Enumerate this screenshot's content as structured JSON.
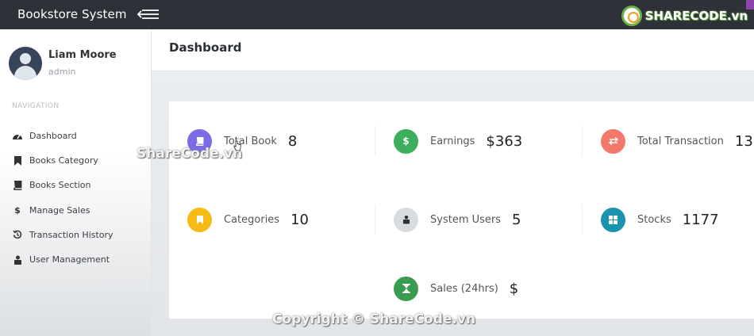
{
  "app": {
    "brand": "Bookstore System"
  },
  "watermark": {
    "logo_text": "SHARECODE.vn",
    "center_text": "ShareCode.vn",
    "footer_text": "Copyright © ShareCode.vn"
  },
  "user": {
    "name": "Liam Moore",
    "role": "admin"
  },
  "nav": {
    "header": "NAVIGATION",
    "items": [
      {
        "label": "Dashboard",
        "icon": "dashboard-icon"
      },
      {
        "label": "Books Category",
        "icon": "bookmark-icon"
      },
      {
        "label": "Books Section",
        "icon": "book-icon"
      },
      {
        "label": "Manage Sales",
        "icon": "dollar-icon"
      },
      {
        "label": "Transaction History",
        "icon": "history-icon"
      },
      {
        "label": "User Management",
        "icon": "user-lock-icon"
      }
    ]
  },
  "page": {
    "title": "Dashboard"
  },
  "stats": [
    {
      "label": "Total Book",
      "value": "8",
      "icon": "book-icon",
      "color": "#7b6be4"
    },
    {
      "label": "Earnings",
      "value": "$363",
      "icon": "dollar-icon",
      "color": "#3dae5c"
    },
    {
      "label": "Total Transaction",
      "value": "13",
      "icon": "exchange-icon",
      "color": "#f2786c"
    },
    {
      "label": "Categories",
      "value": "10",
      "icon": "bookmark-icon",
      "color": "#f7bb16"
    },
    {
      "label": "System Users",
      "value": "5",
      "icon": "user-lock-icon",
      "color": "#d9dcdf"
    },
    {
      "label": "Stocks",
      "value": "1177",
      "icon": "grid-icon",
      "color": "#1a94ae"
    },
    {
      "label": "Sales (24hrs)",
      "value": "$",
      "icon": "hourglass-icon",
      "color": "#3a9c4f"
    }
  ]
}
